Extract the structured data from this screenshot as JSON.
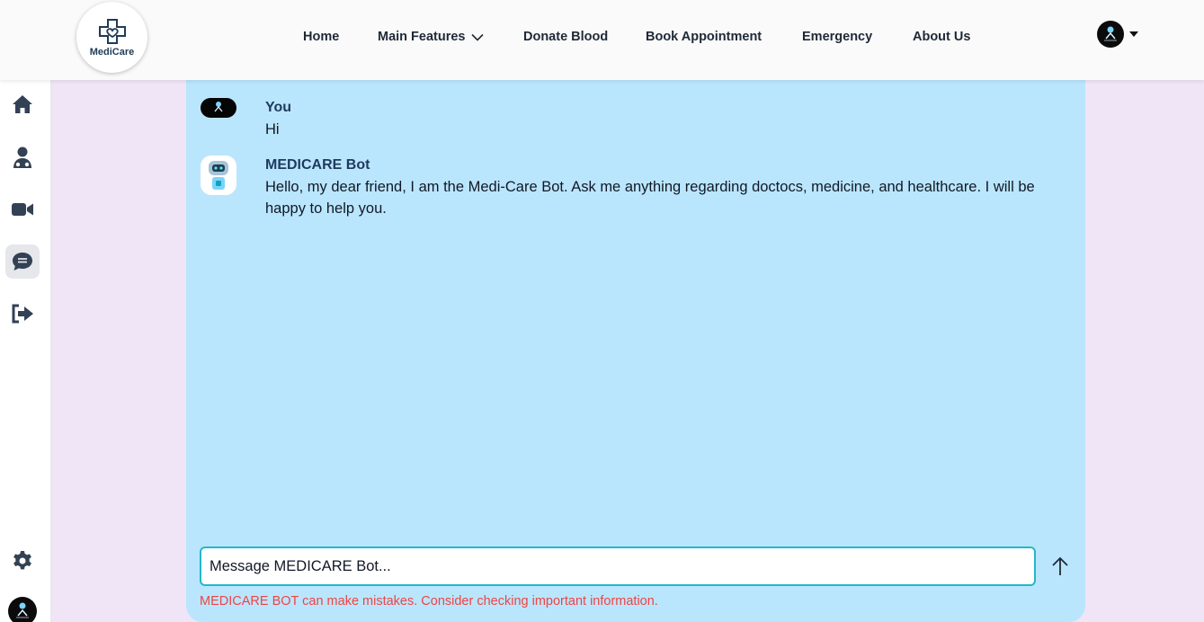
{
  "header": {
    "logo_text": "MediCare",
    "nav": [
      {
        "label": "Home"
      },
      {
        "label": "Main Features"
      },
      {
        "label": "Donate Blood"
      },
      {
        "label": "Book Appointment"
      },
      {
        "label": "Emergency"
      },
      {
        "label": "About Us"
      }
    ]
  },
  "sidebar": {
    "items": [
      {
        "icon": "home-icon"
      },
      {
        "icon": "doctor-icon"
      },
      {
        "icon": "video-icon"
      },
      {
        "icon": "chat-icon",
        "active": true
      },
      {
        "icon": "logout-icon"
      },
      {
        "icon": "gear-icon"
      }
    ]
  },
  "chat": {
    "messages": [
      {
        "sender": "You",
        "text": "Hi"
      },
      {
        "sender": "MEDICARE Bot",
        "text": "Hello, my dear friend, I am the Medi-Care Bot. Ask me anything regarding doctocs, medicine, and healthcare. I will be happy to help you."
      }
    ],
    "input_placeholder": "Message MEDICARE Bot...",
    "disclaimer": "MEDICARE BOT can make mistakes. Consider checking important information."
  },
  "colors": {
    "accent": "#22b8c9",
    "chat_bg": "#bae6fd",
    "page_bg": "#efe5f7",
    "warning": "#ef4444"
  }
}
